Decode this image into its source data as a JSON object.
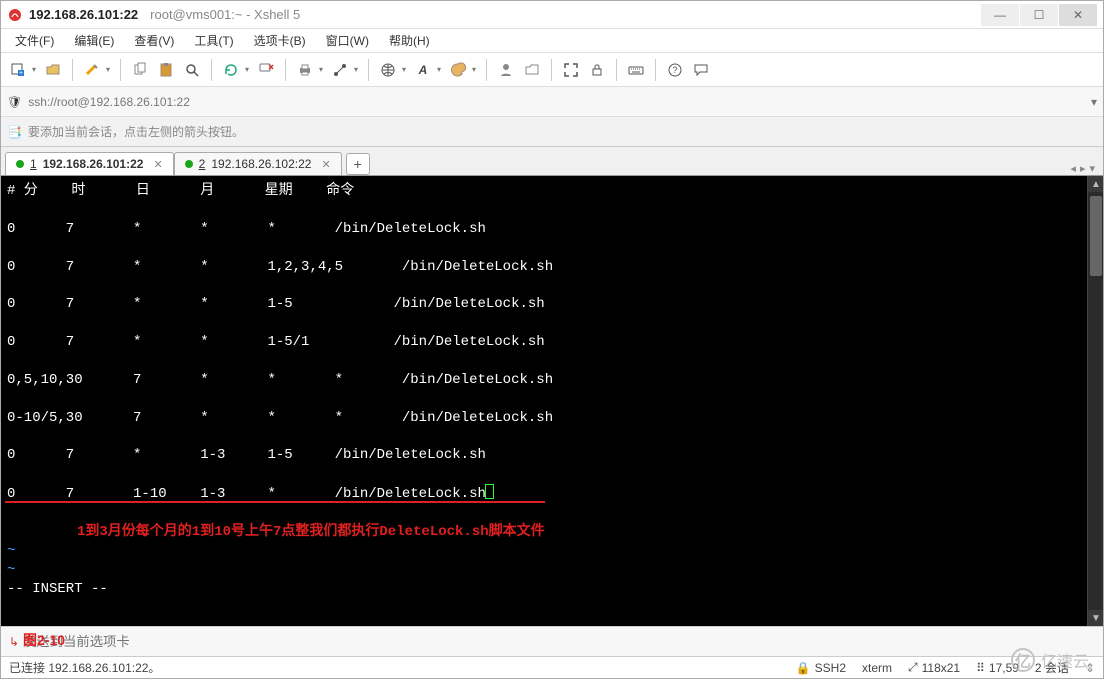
{
  "title": {
    "session_ip": "192.168.26.101:22",
    "rest": "root@vms001:~ - Xshell 5"
  },
  "menubar": [
    "文件(F)",
    "编辑(E)",
    "查看(V)",
    "工具(T)",
    "选项卡(B)",
    "窗口(W)",
    "帮助(H)"
  ],
  "iconrow": {
    "names_left": [
      "new-session-icon",
      "open-icon",
      "sep",
      "properties-icon",
      "sep",
      "copy-icon",
      "paste-icon",
      "search-icon",
      "sep",
      "reconnect-icon",
      "reconnect-dd",
      "disconnect-icon",
      "sep",
      "print-icon",
      "print-dd",
      "net-icon",
      "net-dd",
      "sep",
      "globe-icon",
      "globe-dd",
      "font-icon",
      "font-dd",
      "palette-icon",
      "palette-dd",
      "sep",
      "user-icon",
      "folder-icon",
      "sep",
      "fullscreen-icon",
      "lock-icon",
      "sep",
      "keyboard-icon",
      "sep",
      "help-icon",
      "chat-icon"
    ]
  },
  "addr": {
    "url": "ssh://root@192.168.26.101:22"
  },
  "hint": "要添加当前会话，点击左侧的箭头按钮。",
  "tabs": [
    {
      "num": "1",
      "label": "192.168.26.101:22",
      "active": true
    },
    {
      "num": "2",
      "label": "192.168.26.102:22",
      "active": false
    }
  ],
  "terminal": {
    "header": "# 分    时      日      月      星期    命令",
    "rows": [
      "0      7       *       *       *       /bin/DeleteLock.sh",
      "0      7       *       *       1,2,3,4,5       /bin/DeleteLock.sh",
      "0      7       *       *       1-5            /bin/DeleteLock.sh",
      "0      7       *       *       1-5/1          /bin/DeleteLock.sh",
      "0,5,10,30      7       *       *       *       /bin/DeleteLock.sh",
      "0-10/5,30      7       *       *       *       /bin/DeleteLock.sh",
      "0      7       *       1-3     1-5     /bin/DeleteLock.sh",
      "0      7       1-10    1-3     *       /bin/DeleteLock.sh"
    ],
    "annotation_red": "1到3月份每个月的1到10号上午7点整我们都执行DeleteLock.sh脚本文件",
    "mode_line": "-- INSERT --",
    "figure_label": "图2-10"
  },
  "inputbar": {
    "placeholder": "发送到当前选项卡"
  },
  "status": {
    "conn": "已连接 192.168.26.101:22。",
    "proto": "SSH2",
    "term": "xterm",
    "size": "118x21",
    "cursor": "17,59",
    "sessions": "2 会话"
  },
  "watermark": "亿速云"
}
